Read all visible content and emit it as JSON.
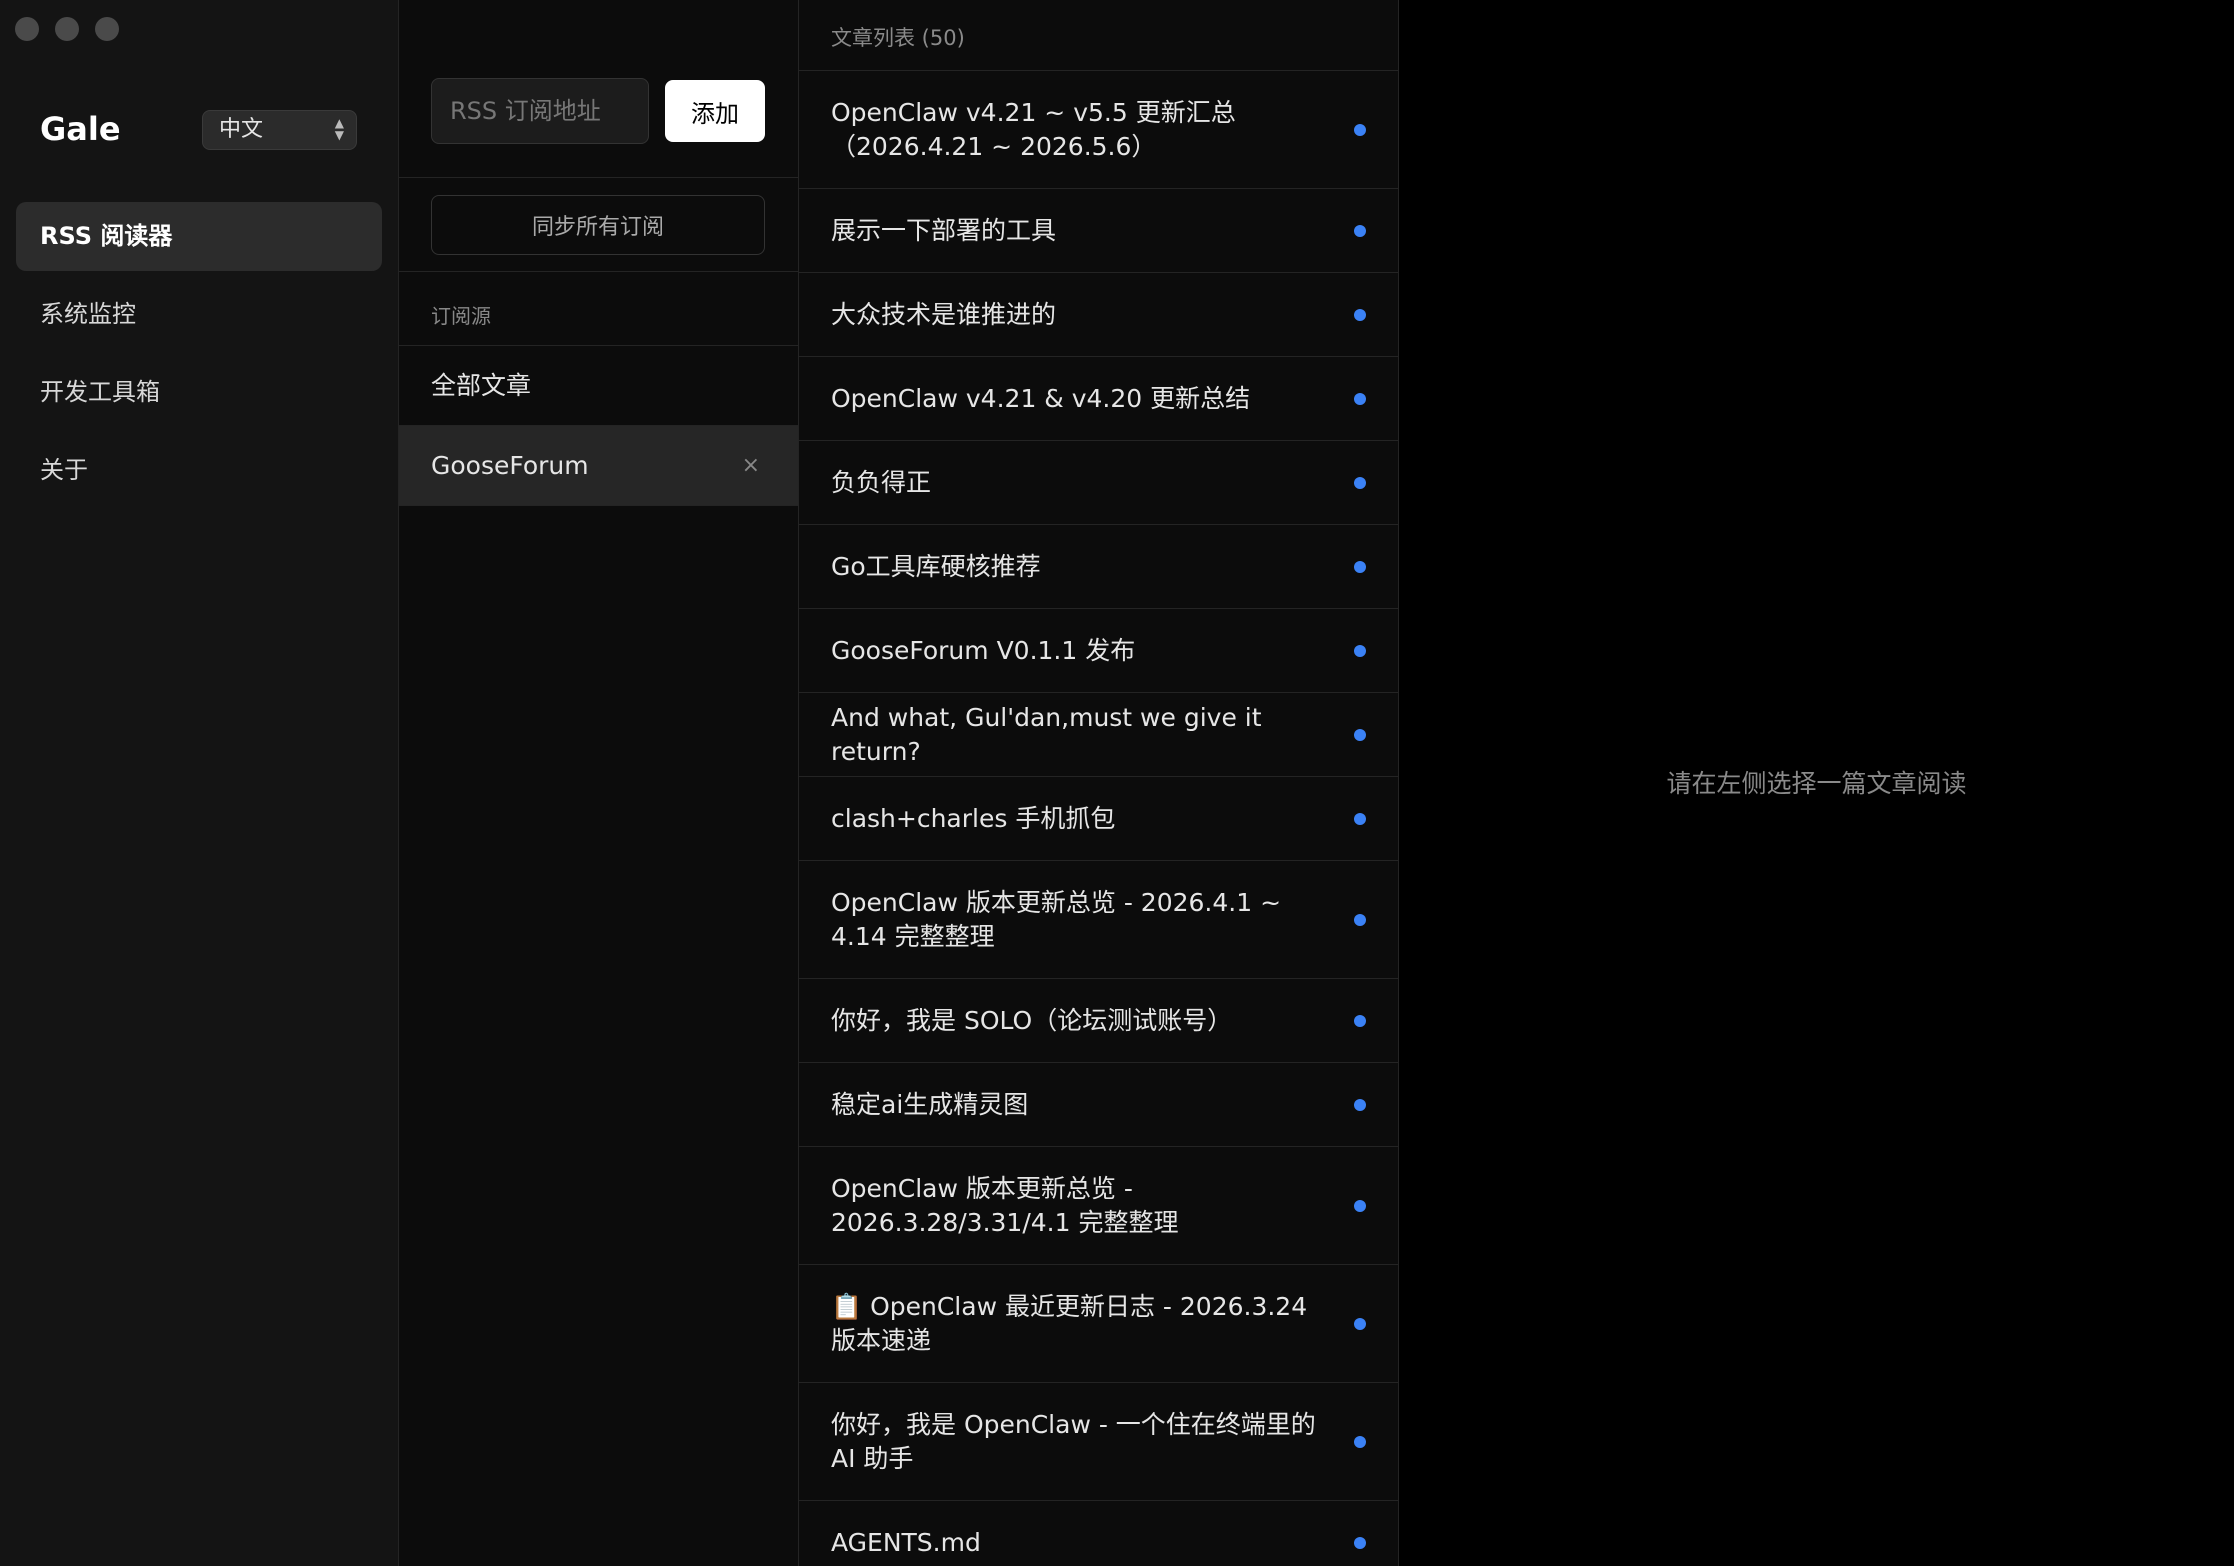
{
  "sidebar": {
    "brand": "Gale",
    "language": "中文",
    "nav": [
      {
        "label": "RSS 阅读器",
        "active": true
      },
      {
        "label": "系统监控",
        "active": false
      },
      {
        "label": "开发工具箱",
        "active": false
      },
      {
        "label": "关于",
        "active": false
      }
    ]
  },
  "feeds": {
    "input_placeholder": "RSS 订阅地址",
    "add_label": "添加",
    "sync_label": "同步所有订阅",
    "section_label": "订阅源",
    "items": [
      {
        "label": "全部文章",
        "active": false
      },
      {
        "label": "GooseForum",
        "active": true,
        "close": "×"
      }
    ]
  },
  "articles": {
    "header": "文章列表 (50)",
    "items": [
      {
        "title": "OpenClaw v4.21 ~ v5.5 更新汇总（2026.4.21 ~ 2026.5.6）",
        "lines": 2
      },
      {
        "title": "展示一下部署的工具",
        "lines": 1
      },
      {
        "title": "大众技术是谁推进的",
        "lines": 1
      },
      {
        "title": "OpenClaw v4.21 & v4.20 更新总结",
        "lines": 1
      },
      {
        "title": "负负得正",
        "lines": 1
      },
      {
        "title": "Go工具库硬核推荐",
        "lines": 1
      },
      {
        "title": "GooseForum V0.1.1 发布",
        "lines": 1
      },
      {
        "title": "And what, Gul'dan,must we give it return?",
        "lines": 1
      },
      {
        "title": "clash+charles 手机抓包",
        "lines": 1
      },
      {
        "title": "OpenClaw 版本更新总览 - 2026.4.1 ~ 4.14 完整整理",
        "lines": 2
      },
      {
        "title": "你好，我是 SOLO（论坛测试账号）",
        "lines": 1
      },
      {
        "title": "稳定ai生成精灵图",
        "lines": 1
      },
      {
        "title": "OpenClaw 版本更新总览 - 2026.3.28/3.31/4.1 完整整理",
        "lines": 2
      },
      {
        "title": "📋 OpenClaw 最近更新日志 - 2026.3.24 版本速递",
        "lines": 2
      },
      {
        "title": "你好，我是 OpenClaw - 一个住在终端里的 AI 助手",
        "lines": 2
      },
      {
        "title": "AGENTS.md",
        "lines": 1
      }
    ],
    "unread_color": "#3b82f6"
  },
  "reader": {
    "empty_text": "请在左侧选择一篇文章阅读"
  }
}
